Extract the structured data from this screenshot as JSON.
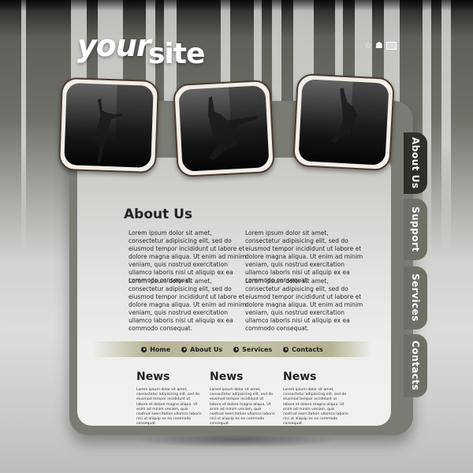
{
  "header": {
    "logo_part1": "your",
    "logo_part2": "site",
    "icons": [
      "star-icon",
      "home-icon",
      "mail-icon"
    ]
  },
  "colors": {
    "panel_border": "#7a7b72",
    "tab_active": "#2f302c",
    "tab_inactive": "#6e6f66",
    "nav_bar": "#c4c2a8"
  },
  "side_tabs": [
    {
      "label": "About Us",
      "active": true
    },
    {
      "label": "Support",
      "active": false
    },
    {
      "label": "Services",
      "active": false
    },
    {
      "label": "Contacts",
      "active": false
    }
  ],
  "about": {
    "title": "About Us",
    "paragraphs": [
      "Lorem ipsum dolor sit amet, consectetur adipisicing elit, sed do eiusmod tempor incididunt ut labore et dolore magna aliqua. Ut enim ad minim veniam, quis nostrud exercitation ullamco laboris nisi ut aliquip ex ea commodo consequat.",
      "Lorem ipsum dolor sit amet, consectetur adipisicing elit, sed do eiusmod tempor incididunt ut labore et dolore magna aliqua. Ut enim ad minim veniam, quis nostrud exercitation ullamco laboris nisi ut aliquip ex ea commodo consequat.",
      "Lorem ipsum dolor sit amet, consectetur adipisicing elit, sed do eiusmod tempor incididunt ut labore et dolore magna aliqua. Ut enim ad minim veniam, quis nostrud exercitation ullamco laboris nisi ut aliquip ex ea commodo consequat.",
      "Lorem ipsum dolor sit amet, consectetur adipisicing elit, sed do eiusmod tempor incididunt ut labore et dolore magna aliqua. Ut enim ad minim veniam, quis nostrud exercitation ullamco laboris nisi ut aliquip ex ea commodo consequat."
    ]
  },
  "nav": [
    {
      "label": "Home"
    },
    {
      "label": "About Us"
    },
    {
      "label": "Services"
    },
    {
      "label": "Contacts"
    }
  ],
  "news": [
    {
      "title": "News",
      "text": "Lorem ipsum dolor sit amet, consectetur adipisicing elit, sed do eiusmod tempor incididunt ut labore et dolore magna aliqua. Ut enim ad minim veniam, quis nostrud exercitation ullamco laboris nisi ut aliquip ex ea commodo consequat."
    },
    {
      "title": "News",
      "text": "Lorem ipsum dolor sit amet, consectetur adipisicing elit, sed do eiusmod tempor incididunt ut labore et dolore magna aliqua. Ut enim ad minim veniam, quis nostrud exercitation ullamco laboris nisi ut aliquip ex ea commodo consequat."
    },
    {
      "title": "News",
      "text": "Lorem ipsum dolor sit amet, consectetur adipisicing elit, sed do eiusmod tempor incididunt ut labore et dolore magna aliqua. Ut enim ad minim veniam, quis nostrud exercitation ullamco laboris nisi ut aliquip ex ea commodo consequat."
    }
  ]
}
